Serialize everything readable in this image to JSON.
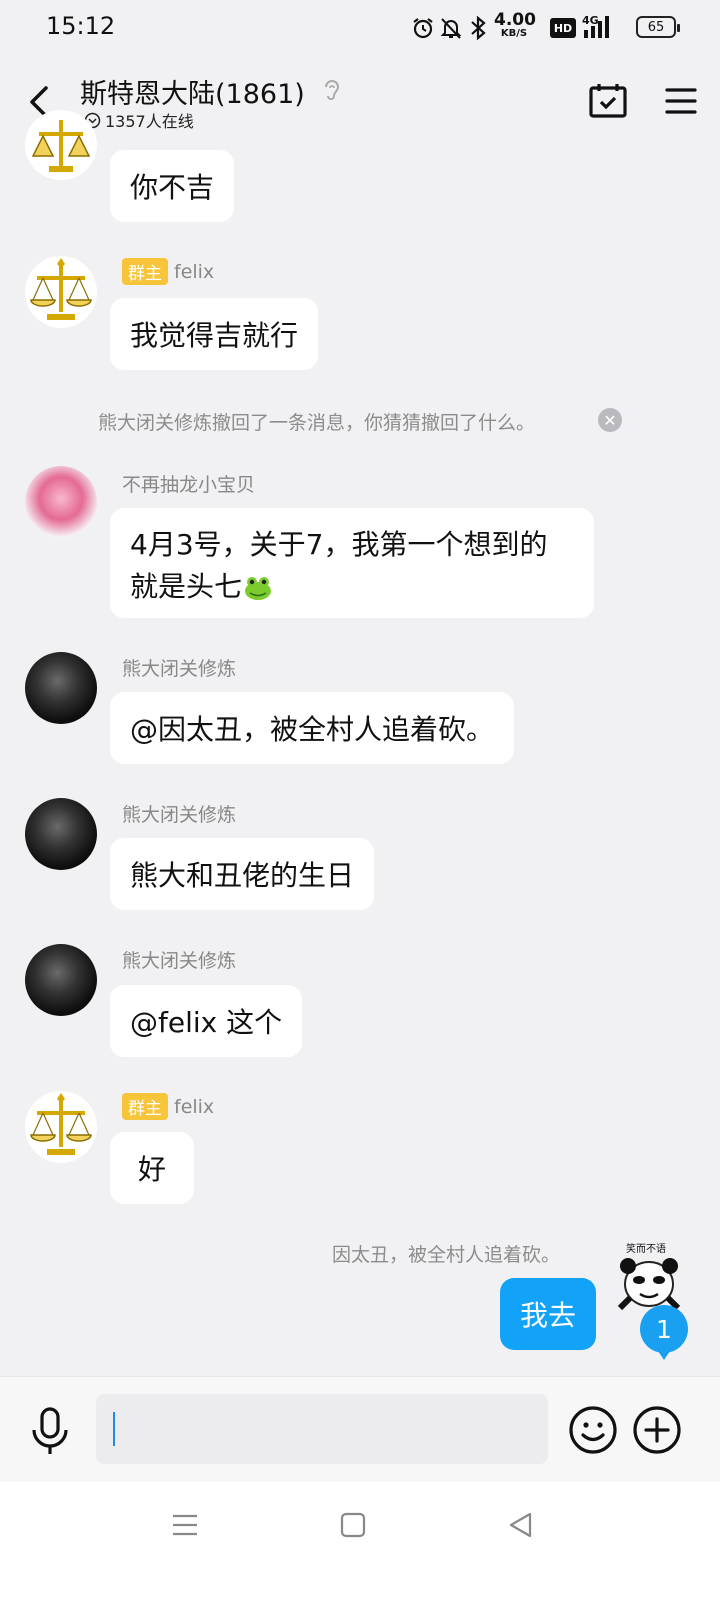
{
  "status_bar": {
    "time": "15:12",
    "net_speed": "4.00",
    "net_speed_unit": "KB/S",
    "hd_label": "HD",
    "network_label": "4G",
    "battery": "65"
  },
  "header": {
    "title": "斯特恩大陆(1861)",
    "online_count": "1357人在线"
  },
  "messages": [
    {
      "sender": "",
      "badge": "",
      "text": "你不吉"
    },
    {
      "sender": "felix",
      "badge": "群主",
      "text": "我觉得吉就行"
    },
    {
      "sender": "不再抽龙小宝贝",
      "badge": "",
      "text_line1": "4月3号，关于7，我第一个想到的",
      "text_line2": "就是头七"
    },
    {
      "sender": "熊大闭关修炼",
      "badge": "",
      "text": "@因太丑，被全村人追着砍。"
    },
    {
      "sender": "熊大闭关修炼",
      "badge": "",
      "text": "熊大和丑佬的生日"
    },
    {
      "sender": "熊大闭关修炼",
      "badge": "",
      "text": "@felix 这个"
    },
    {
      "sender": "felix",
      "badge": "群主",
      "text": "好"
    }
  ],
  "system_notice": "熊大闭关修炼撤回了一条消息，你猜猜撤回了什么。",
  "self_message": {
    "quote": "因太丑，被全村人追着砍。",
    "text": "我去",
    "sticker_text": "笑而不语"
  },
  "unread_count": "1",
  "input": {
    "value": "",
    "placeholder": ""
  },
  "colors": {
    "accent": "#12a2f7",
    "owner_badge": "#f7c43a",
    "background": "#f1f1f3"
  }
}
